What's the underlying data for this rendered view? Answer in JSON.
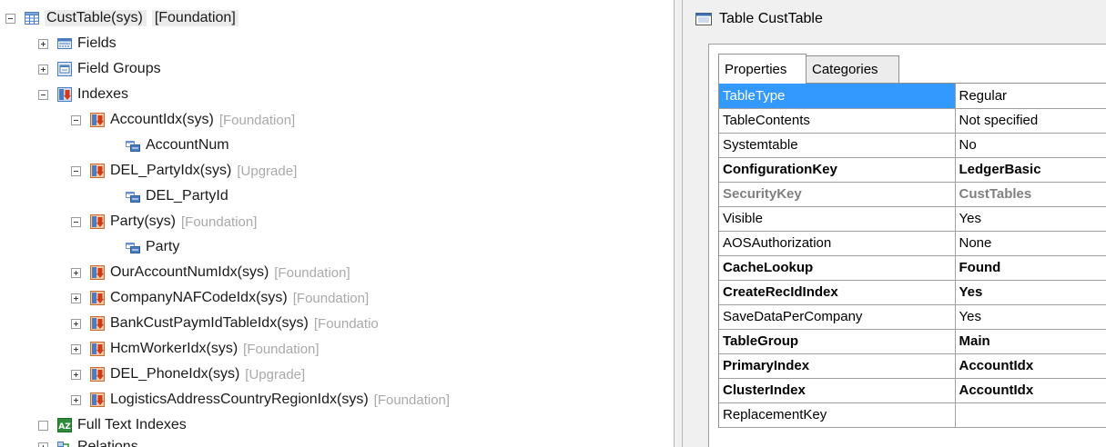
{
  "tree": {
    "root": {
      "label": "CustTable(sys)",
      "layer": "[Foundation]"
    },
    "nodes": {
      "fields": "Fields",
      "field_groups": "Field Groups",
      "indexes": "Indexes",
      "full_text_indexes": "Full Text Indexes",
      "relations": "Relations"
    },
    "indexes": [
      {
        "label": "AccountIdx(sys)",
        "layer": "[Foundation]",
        "field": "AccountNum"
      },
      {
        "label": "DEL_PartyIdx(sys)",
        "layer": "[Upgrade]",
        "field": "DEL_PartyId"
      },
      {
        "label": "Party(sys)",
        "layer": "[Foundation]",
        "field": "Party"
      },
      {
        "label": "OurAccountNumIdx(sys)",
        "layer": "[Foundation]"
      },
      {
        "label": "CompanyNAFCodeIdx(sys)",
        "layer": "[Foundation]"
      },
      {
        "label": "BankCustPaymIdTableIdx(sys)",
        "layer": "[Foundatio"
      },
      {
        "label": "HcmWorkerIdx(sys)",
        "layer": "[Foundation]"
      },
      {
        "label": "DEL_PhoneIdx(sys)",
        "layer": "[Upgrade]"
      },
      {
        "label": "LogisticsAddressCountryRegionIdx(sys)",
        "layer": "[Foundation]"
      }
    ]
  },
  "properties_window": {
    "title": "Table CustTable",
    "tabs": [
      "Properties",
      "Categories"
    ],
    "rows": [
      {
        "key": "TableType",
        "value": "Regular",
        "style": "selected"
      },
      {
        "key": "TableContents",
        "value": "Not specified",
        "style": "normal"
      },
      {
        "key": "Systemtable",
        "value": "No",
        "style": "normal"
      },
      {
        "key": "ConfigurationKey",
        "value": "LedgerBasic",
        "style": "bold"
      },
      {
        "key": "SecurityKey",
        "value": "CustTables",
        "style": "dim"
      },
      {
        "key": "Visible",
        "value": "Yes",
        "style": "normal"
      },
      {
        "key": "AOSAuthorization",
        "value": "None",
        "style": "normal"
      },
      {
        "key": "CacheLookup",
        "value": "Found",
        "style": "bold"
      },
      {
        "key": "CreateRecIdIndex",
        "value": "Yes",
        "style": "bold"
      },
      {
        "key": "SaveDataPerCompany",
        "value": "Yes",
        "style": "normal"
      },
      {
        "key": "TableGroup",
        "value": "Main",
        "style": "bold"
      },
      {
        "key": "PrimaryIndex",
        "value": "AccountIdx",
        "style": "bold"
      },
      {
        "key": "ClusterIndex",
        "value": "AccountIdx",
        "style": "bold"
      },
      {
        "key": "ReplacementKey",
        "value": "",
        "style": "normal"
      }
    ]
  },
  "colors": {
    "selection": "#3399ff",
    "layer_text": "#a9a9a9",
    "index_icon_red": "#d33a1a",
    "index_icon_blue": "#4a7cc0"
  }
}
